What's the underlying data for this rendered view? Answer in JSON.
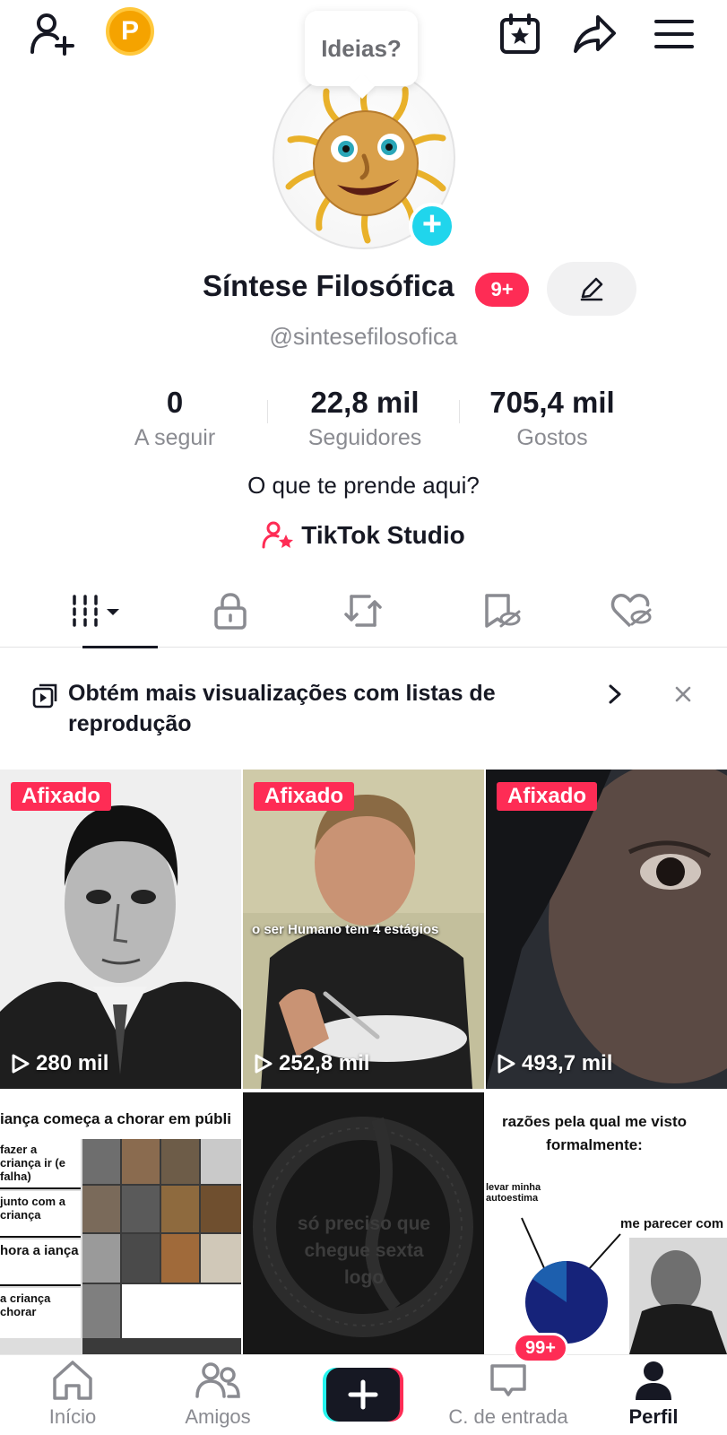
{
  "header": {
    "coin_letter": "P",
    "ideas_bubble": "Ideias?"
  },
  "profile": {
    "name": "Síntese Filosófica",
    "notification_badge": "9+",
    "handle": "@sintesefilosofica",
    "stats": [
      {
        "value": "0",
        "label": "A seguir"
      },
      {
        "value": "22,8 mil",
        "label": "Seguidores"
      },
      {
        "value": "705,4 mil",
        "label": "Gostos"
      }
    ],
    "bio": "O que te prende aqui?",
    "studio_link": "TikTok Studio"
  },
  "banner": {
    "text": "Obtém mais visualizações com listas de reprodução"
  },
  "videos": [
    {
      "pinned_label": "Afixado",
      "views": "280 mil"
    },
    {
      "pinned_label": "Afixado",
      "views": "252,8 mil",
      "caption": "o ser Humano tem 4 estágios"
    },
    {
      "pinned_label": "Afixado",
      "views": "493,7 mil"
    },
    {
      "caption": "iança começa a chorar em públi",
      "rows": [
        "fazer a criança ir (e falha)",
        "junto com a criança",
        "hora a iança",
        "a criança chorar"
      ]
    },
    {
      "caption": "só preciso que chegue sexta logo"
    },
    {
      "caption": "razões pela qual me visto formalmente:",
      "label_a": "levar minha autoestima",
      "label_b": "me parecer com"
    }
  ],
  "bottom_nav": {
    "items": [
      "Início",
      "Amigos",
      "",
      "C. de entrada",
      "Perfil"
    ],
    "inbox_badge": "99+"
  },
  "colors": {
    "accent": "#fe2c55",
    "cyan": "#20d5ec",
    "text_primary": "#161823",
    "text_secondary": "#8a8b91"
  }
}
